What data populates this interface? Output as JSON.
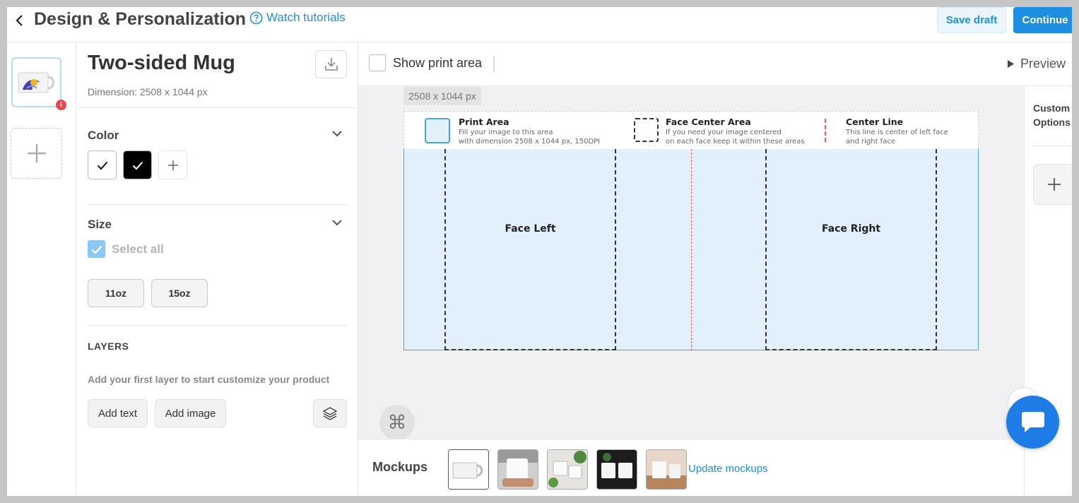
{
  "header": {
    "title": "Design & Personalization",
    "watch_tutorials": "Watch tutorials",
    "save_draft": "Save draft",
    "continue": "Continue"
  },
  "thumbnails": {
    "badge": "i"
  },
  "product": {
    "name": "Two-sided Mug",
    "dimension": "Dimension: 2508 x 1044 px"
  },
  "color": {
    "title": "Color",
    "swatches": [
      {
        "name": "white",
        "hex": "#ffffff",
        "selected": true
      },
      {
        "name": "black",
        "hex": "#000000",
        "selected": true
      }
    ]
  },
  "size": {
    "title": "Size",
    "select_all": "Select all",
    "options": [
      "11oz",
      "15oz"
    ]
  },
  "layers": {
    "title": "LAYERS",
    "hint": "Add your first layer to start customize your product",
    "add_text": "Add text",
    "add_image": "Add image"
  },
  "toolbar": {
    "show_print_area": "Show print area",
    "preview": "Preview"
  },
  "canvas": {
    "dimension_tag": "2508 x 1044 px",
    "legend": {
      "print_area_title": "Print Area",
      "print_area_desc1": "Fill your image to this area",
      "print_area_desc2": "with dimension 2508 x 1044 px, 150DPI",
      "face_center_title": "Face Center Area",
      "face_center_desc1": " If you need your image centered",
      "face_center_desc2": "on each face keep it within these areas",
      "center_line_title": "Center Line",
      "center_line_desc1": "This line is center of left face",
      "center_line_desc2": "and right face"
    },
    "face_left": "Face Left",
    "face_right": "Face Right"
  },
  "options": {
    "title_line1": "Custom",
    "title_line2": "Options"
  },
  "mockups": {
    "label": "Mockups",
    "update": "Update mockups",
    "count": 5
  },
  "colors": {
    "accent": "#1e8fe0",
    "print_area_fill": "#e1f0fa",
    "center_line": "#f05a5a",
    "chat": "#1e7ce6"
  }
}
